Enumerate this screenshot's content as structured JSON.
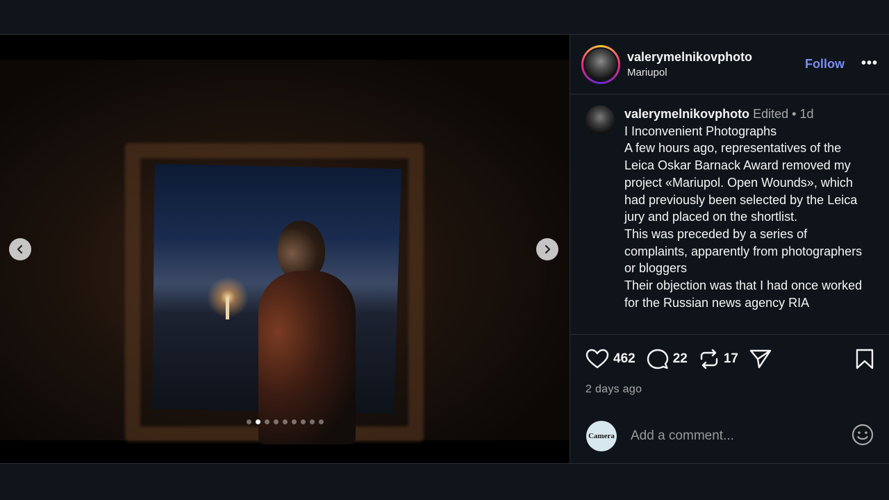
{
  "post": {
    "author": "valerymelnikovphoto",
    "location": "Mariupol",
    "follow_label": "Follow",
    "more_label": "•••",
    "caption_author": "valerymelnikovphoto",
    "edited_label": "Edited",
    "separator": "•",
    "time_ago": "1d",
    "caption_lines": [
      "I Inconvenient Photographs",
      "",
      "A few hours ago, representatives of the Leica Oskar Barnack Award removed my project «Mariupol. Open Wounds», which had previously been selected by the Leica jury and placed on the shortlist.",
      "This was preceded by a series of complaints, apparently from photographers or bloggers",
      "Their objection was that I had once worked for the Russian news agency RIA"
    ],
    "likes": "462",
    "comments": "22",
    "reposts": "17",
    "date": "2 days ago"
  },
  "carousel": {
    "slides": 9,
    "active_index": 1
  },
  "comment_box": {
    "placeholder": "Add a comment...",
    "avatar_text": "Camera"
  },
  "icons": {
    "prev": "chevron-left-icon",
    "next": "chevron-right-icon",
    "like": "heart-icon",
    "comment": "comment-bubble-icon",
    "repost": "repost-icon",
    "share": "send-icon",
    "save": "bookmark-icon",
    "emoji": "smiley-icon"
  },
  "colors": {
    "follow_accent": "#7b8cf0",
    "background": "#0f141a"
  }
}
